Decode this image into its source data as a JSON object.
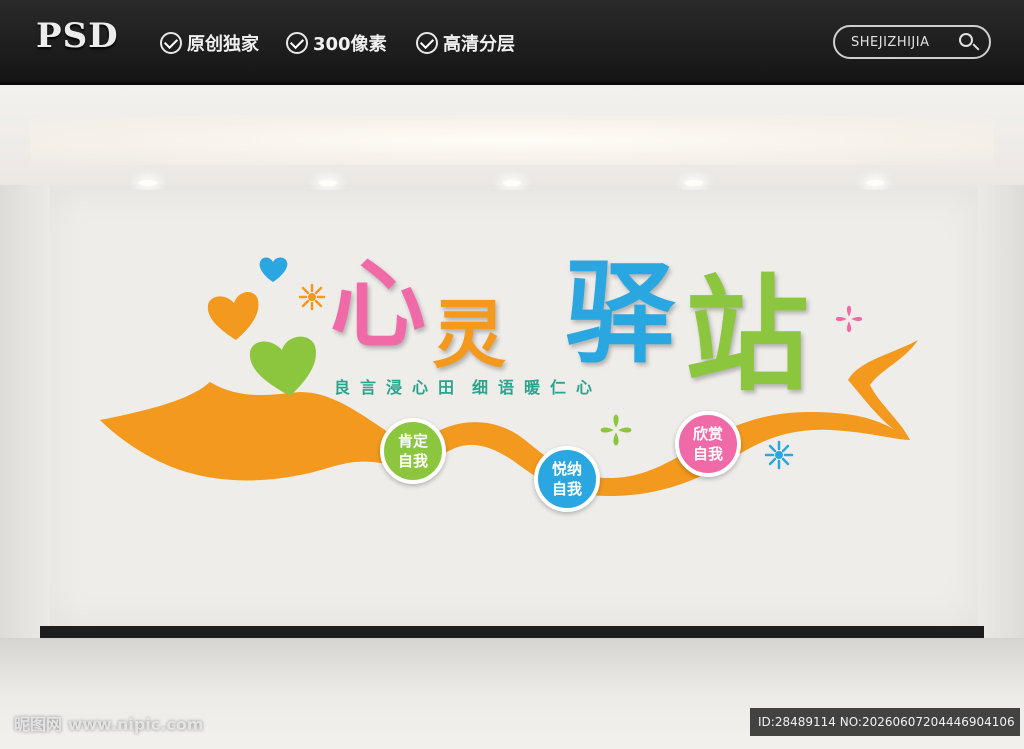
{
  "header": {
    "brand": "PSD",
    "features": [
      "原创独家",
      "300像素",
      "高清分层"
    ],
    "search_text": "SHEJIZHIJIA"
  },
  "artwork": {
    "title_chars": [
      "心",
      "灵",
      "驿",
      "站"
    ],
    "title_colors": [
      "#f06aa8",
      "#f39a1e",
      "#2aa6e0",
      "#8cc63f"
    ],
    "slogan_chars": [
      "良",
      "言",
      "浸",
      "心",
      "田",
      "细",
      "语",
      "暖",
      "仁",
      "心"
    ],
    "bubbles": [
      {
        "line1": "肯定",
        "line2": "自我",
        "color": "#8cc63f"
      },
      {
        "line1": "悦纳",
        "line2": "自我",
        "color": "#2aa6e0"
      },
      {
        "line1": "欣赏",
        "line2": "自我",
        "color": "#f06aa8"
      }
    ]
  },
  "footer": {
    "watermark": "昵图网 www.nipic.com",
    "id_text": "ID:28489114 NO:20260607204446904106"
  }
}
